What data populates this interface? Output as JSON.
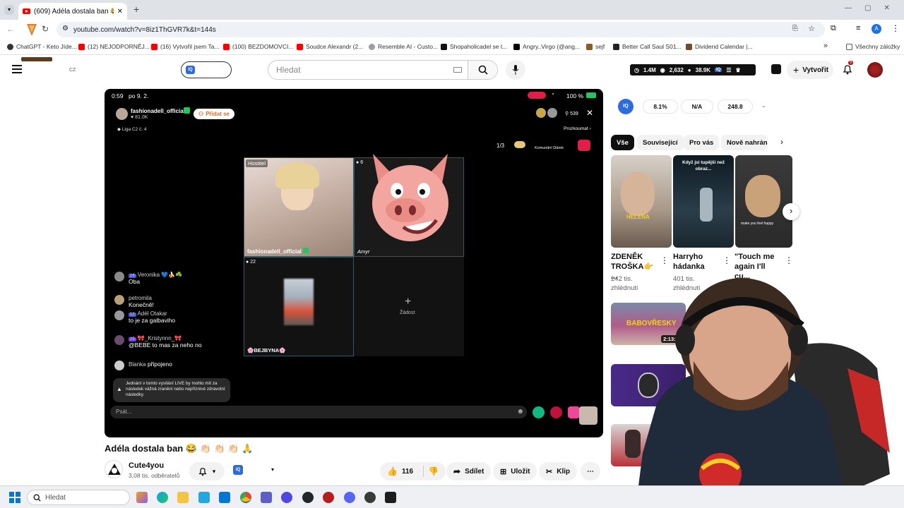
{
  "browser": {
    "tab_title": "(609) Adéla dostala ban 😂 👏🏻 👏",
    "new_tab": "+",
    "url": "youtube.com/watch?v=8iz1ThGVR7k&t=144s",
    "bookmarks": [
      "ChatGPT - Keto Jíde...",
      "(12) NEJODPORNĚJ...",
      "(16) Vytvořil jsem Ta...",
      "(100) BEZDOMOVCI...",
      "Soudce Alexandr (2...",
      "Resemble AI - Custo...",
      "Shopaholicadel se t...",
      "Angry..Virgo (@ang...",
      "sejf",
      "Better Call Saul S01...",
      "Dividend Calendar |..."
    ],
    "bookmarks_more": "»",
    "all_bookmarks": "Všechny záložky"
  },
  "header": {
    "country": "CZ",
    "search_placeholder": "Hledat",
    "stats": [
      "1.4M",
      "2,632",
      "38.9K"
    ],
    "create_label": "Vytvořit",
    "notif_count": "9"
  },
  "video": {
    "status_time": "0:59",
    "status_date": "po 9. 2.",
    "battery": "100 %",
    "host_name": "fashionadell_official",
    "host_likes": "81.0K",
    "join_label": "Přidat se",
    "viewer_count": "539",
    "league": "Liga C2 č. 4",
    "explore": "Prozkoumat",
    "progress": "1/3",
    "community_gift": "Komunitní Dárek",
    "host_tag": "Hostitel",
    "cell_host_name": "fashionadell_official",
    "cell2_count": "6",
    "cell2_name": "Amyr",
    "cell3_count": "22",
    "cell3_name": "🌸BEJBYNA🌸",
    "request_label": "Žádost",
    "chat": [
      {
        "badge": "16",
        "name": "Veronika 💙🍌☘️",
        "text": "Oba"
      },
      {
        "name": "petromila",
        "text": "Konečně!"
      },
      {
        "badge": "12",
        "name": "Adél Otakar",
        "text": "to je za galbaviho"
      },
      {
        "badge": "25",
        "name": "🎀_Kristynnn_🎀",
        "text": "@BEBE to mas za neho no"
      },
      {
        "name": "Blanka",
        "text": "připojeno"
      }
    ],
    "warning": "Jednání v tomto vysílání LIVE by mohlo mít za následek vážná zranění nebo nepříznivé zdravotní následky.",
    "input_placeholder": "Psát..."
  },
  "below": {
    "title": "Adéla dostala ban 😂 👏🏻 👏🏻 👏🏻 🙏",
    "channel": "Cute4you",
    "subscribers": "3,08 tis. odběratelů",
    "likes": "116",
    "share": "Sdílet",
    "save": "Uložit",
    "clip": "Klip"
  },
  "sidebar": {
    "stats": [
      "8.1%",
      "N/A",
      "248.8"
    ],
    "chips": [
      "Vše",
      "Související",
      "Pro vás",
      "Nově nahráno"
    ],
    "shorts": [
      {
        "title": "ZDENĚK TROŠKA👉 ...",
        "views": "242 tis.",
        "views2": "zhlédnutí",
        "overlay": "HELENA"
      },
      {
        "title": "Harryho hádanka",
        "views": "401 tis.",
        "views2": "zhlédnutí",
        "overlay": "Když jsi tupější než obraz..."
      },
      {
        "title": "\"Touch me again I'll cu...",
        "views": "",
        "views2": "",
        "overlay": "make you feel happy"
      }
    ],
    "video1_duration": "2:13:20",
    "video1_overlay": "BABOVŘESKY"
  },
  "taskbar": {
    "search_placeholder": "Hledat"
  },
  "colors": {
    "accent": "#065fd4",
    "yt_red": "#ff0000",
    "status_green": "#22c55e"
  }
}
